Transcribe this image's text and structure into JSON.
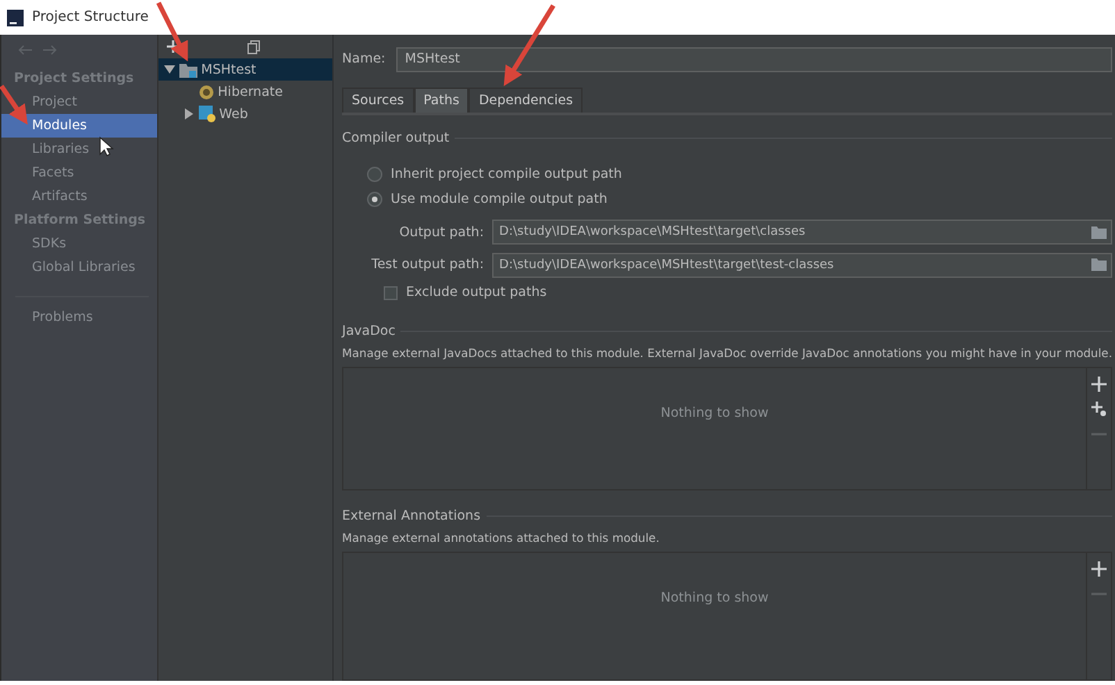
{
  "window": {
    "title": "Project Structure"
  },
  "sidebar": {
    "sections": [
      {
        "heading": "Project Settings",
        "items": [
          {
            "label": "Project",
            "selected": false
          },
          {
            "label": "Modules",
            "selected": true
          },
          {
            "label": "Libraries",
            "selected": false
          },
          {
            "label": "Facets",
            "selected": false
          },
          {
            "label": "Artifacts",
            "selected": false
          }
        ]
      },
      {
        "heading": "Platform Settings",
        "items": [
          {
            "label": "SDKs",
            "selected": false
          },
          {
            "label": "Global Libraries",
            "selected": false
          }
        ]
      }
    ],
    "footer_items": [
      {
        "label": "Problems",
        "selected": false
      }
    ]
  },
  "tree": {
    "nodes": [
      {
        "label": "MSHtest",
        "kind": "module",
        "selected": true,
        "expanded": true,
        "children": [
          {
            "label": "Hibernate",
            "kind": "hibernate",
            "selected": false
          },
          {
            "label": "Web",
            "kind": "web",
            "selected": false,
            "expanded": false
          }
        ]
      }
    ]
  },
  "module": {
    "name_label": "Name:",
    "name": "MSHtest",
    "tabs": [
      {
        "label": "Sources",
        "selected": false
      },
      {
        "label": "Paths",
        "selected": true
      },
      {
        "label": "Dependencies",
        "selected": false
      }
    ],
    "compiler_output": {
      "title": "Compiler output",
      "options": [
        {
          "label": "Inherit project compile output path",
          "selected": false
        },
        {
          "label": "Use module compile output path",
          "selected": true
        }
      ],
      "paths": [
        {
          "label": "Output path:",
          "value": "D:\\study\\IDEA\\workspace\\MSHtest\\target\\classes"
        },
        {
          "label": "Test output path:",
          "value": "D:\\study\\IDEA\\workspace\\MSHtest\\target\\test-classes"
        }
      ],
      "exclude": {
        "label": "Exclude output paths",
        "checked": false
      }
    },
    "panels": [
      {
        "title": "JavaDoc",
        "description": "Manage external JavaDocs attached to this module. External JavaDoc override JavaDoc annotations you might have in your module.",
        "empty_text": "Nothing to show",
        "actions": [
          {
            "kind": "add",
            "disabled": false
          },
          {
            "kind": "add-special",
            "disabled": false
          },
          {
            "kind": "remove",
            "disabled": true
          }
        ]
      },
      {
        "title": "External Annotations",
        "description": "Manage external annotations attached to this module.",
        "empty_text": "Nothing to show",
        "actions": [
          {
            "kind": "add",
            "disabled": false
          },
          {
            "kind": "remove",
            "disabled": true
          }
        ]
      }
    ]
  }
}
